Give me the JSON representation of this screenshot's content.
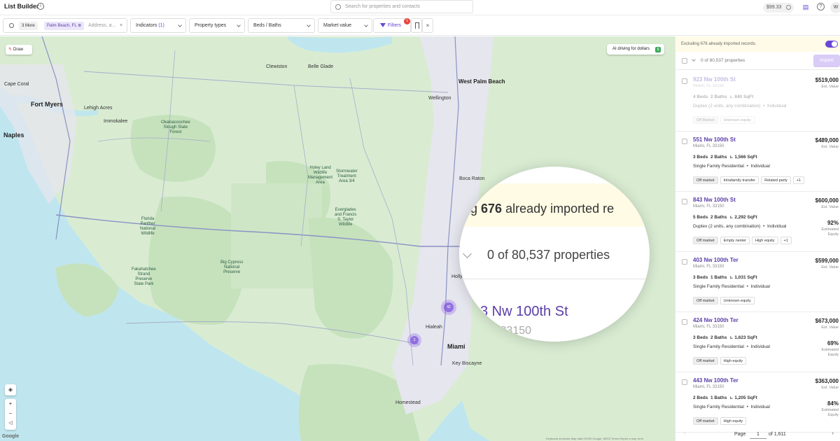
{
  "app": {
    "title": "List Builder"
  },
  "top": {
    "search_placeholder": "Search for properties and contacts",
    "credits": "$99.33",
    "avatar_initial": "W"
  },
  "filters": {
    "more_chip": "3 More",
    "location_chip": "Palm Beach, FL",
    "location_placeholder": "Address, a...",
    "indicators_label": "Indicators",
    "indicators_count": "(1)",
    "property_types": "Property types",
    "beds_baths": "Beds / Baths",
    "market_value": "Market value",
    "filters_label": "Filters",
    "filters_badge": "1"
  },
  "map": {
    "draw_label": "Draw",
    "ai_label": "AI driving for dollars",
    "clusters": [
      "42",
      "3"
    ],
    "attribution": "Keyboard shortcuts   Map data ©2025 Google, INEGI   Terms   Report a map error",
    "google": "Google",
    "labels": {
      "fort_myers": "Fort Myers",
      "naples": "Naples",
      "miami": "Miami",
      "west_palm": "West Palm Beach",
      "boca": "Boca Raton",
      "hialeah": "Hialeah",
      "lehigh": "Lehigh Acres",
      "cape_coral": "Cape Coral",
      "okaloacoochee": "Okaloacoochee\nSlough State\nForest",
      "big_cypress": "Big Cypress\nNational\nPreserve",
      "everglades": "Everglades\nand Francis\nS. Taylor\nWildlife",
      "holey_land": "Holey Land\nWildlife\nManagement\nArea",
      "stormwater": "Stormwater\nTreatment\nArea 3/4",
      "florida_panther": "Florida\nPanther\nNational\nWildlife",
      "fakahatchee": "Fakahatchee\nStrand\nPreserve\nState Park",
      "homestead": "Homestead",
      "key_biscayne": "Key Biscayne",
      "hollywood": "Hollywood",
      "immokalee": "Immokalee",
      "wellington": "Wellington",
      "belle_glade": "Belle Glade",
      "clewiston": "Clewiston"
    }
  },
  "magnifier": {
    "line1_prefix": "g ",
    "line1_number": "676",
    "line1_rest": " already imported re",
    "line2": "0 of 80,537 properties",
    "addr": "3 Nw 100th St",
    "city": "FL 33150"
  },
  "panel": {
    "banner": "Excluding 676 already imported records.",
    "count": "0 of 80,537 properties",
    "import": "Import",
    "cards": [
      {
        "addr": "923 Nw 100th St",
        "city": "Miami, FL 33150",
        "beds": "4 Beds",
        "baths": "2 Baths",
        "sqft": "840 SqFt",
        "type": "Duplex (2 units, any combination)",
        "owner": "Individual",
        "tags": [
          "Off Market",
          "Unknown equity"
        ],
        "price": "$519,000",
        "price_label": "Est. Value",
        "equity": "",
        "equity_label": "",
        "faded": true
      },
      {
        "addr": "551 Nw 100th St",
        "city": "Miami, FL 33150",
        "beds": "3 Beds",
        "baths": "2 Baths",
        "sqft": "1,566 SqFt",
        "type": "Single Family Residential",
        "owner": "Individual",
        "tags": [
          "Off market",
          "Intrafamily transfer",
          "Related party",
          "+1"
        ],
        "price": "$489,000",
        "price_label": "Est. Value",
        "equity": "",
        "equity_label": "",
        "faded": false
      },
      {
        "addr": "843 Nw 100th St",
        "city": "Miami, FL 33150",
        "beds": "5 Beds",
        "baths": "2 Baths",
        "sqft": "2,292 SqFt",
        "type": "Duplex (2 units, any combination)",
        "owner": "Individual",
        "tags": [
          "Off market",
          "Empty nester",
          "High equity",
          "+1"
        ],
        "price": "$600,000",
        "price_label": "Est. Value",
        "equity": "92%",
        "equity_label": "Estimated Equity",
        "faded": false
      },
      {
        "addr": "403 Nw 100th Ter",
        "city": "Miami, FL 33150",
        "beds": "3 Beds",
        "baths": "1 Baths",
        "sqft": "1,031 SqFt",
        "type": "Single Family Residential",
        "owner": "Individual",
        "tags": [
          "Off market",
          "Unknown equity"
        ],
        "price": "$599,000",
        "price_label": "Est. Value",
        "equity": "",
        "equity_label": "",
        "faded": false
      },
      {
        "addr": "424 Nw 100th Ter",
        "city": "Miami, FL 33150",
        "beds": "3 Beds",
        "baths": "2 Baths",
        "sqft": "1,623 SqFt",
        "type": "Single Family Residential",
        "owner": "Individual",
        "tags": [
          "Off market",
          "High equity"
        ],
        "price": "$673,000",
        "price_label": "Est. Value",
        "equity": "69%",
        "equity_label": "Estimated Equity",
        "faded": false
      },
      {
        "addr": "443 Nw 100th Ter",
        "city": "Miami, FL 33150",
        "beds": "2 Beds",
        "baths": "1 Baths",
        "sqft": "1,205 SqFt",
        "type": "Single Family Residential",
        "owner": "Individual",
        "tags": [
          "Off market",
          "High equity"
        ],
        "price": "$363,000",
        "price_label": "Est. Value",
        "equity": "84%",
        "equity_label": "Estimated Equity",
        "faded": false
      }
    ],
    "pager": {
      "label": "Page",
      "current": "1",
      "total": "of 1,611"
    }
  },
  "colors": {
    "accent": "#6a47d6",
    "land": "#d9ecd2",
    "water": "#bfe6ef",
    "urban": "#e6e6ee",
    "cluster": "#825adc"
  }
}
